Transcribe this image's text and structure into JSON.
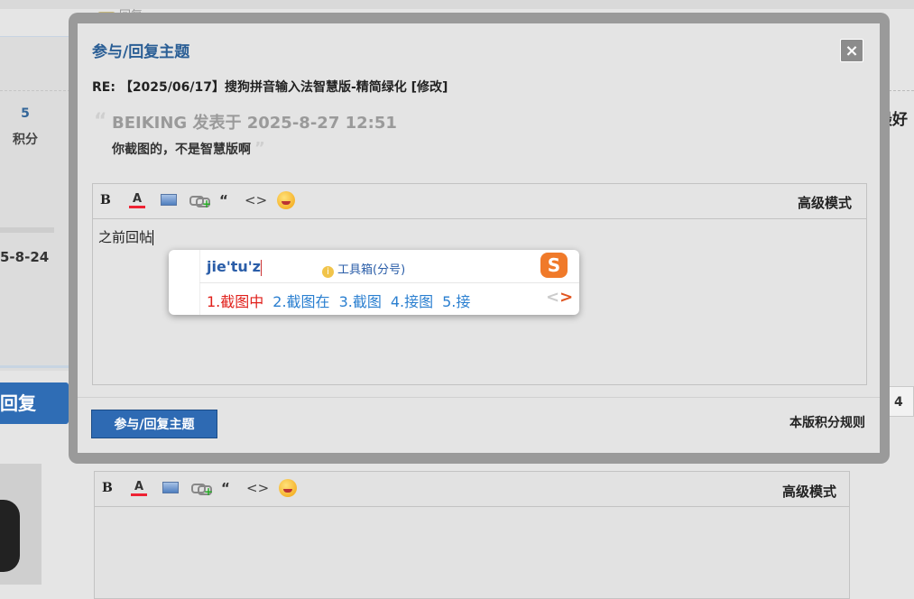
{
  "background": {
    "reply_link": "回复",
    "credits_value": "5",
    "credits_label": "积分",
    "date_fragment": "5-8-24",
    "reply_button": "回复",
    "right_text": "是最好",
    "pager_value": "4",
    "editor": {
      "advanced_mode": "高级模式"
    }
  },
  "dialog": {
    "title": "参与/回复主题",
    "close_glyph": "×",
    "subject": "RE: 【2025/06/17】搜狗拼音输入法智慧版-精简绿化 [修改]",
    "quote": {
      "author_line": "BEIKING 发表于 2025-8-27 12:51",
      "text": "你截图的，不是智慧版啊"
    },
    "editor": {
      "toolbar": {
        "bold": "B",
        "font_color": "A",
        "quote": "“",
        "code": "<>",
        "advanced_mode": "高级模式"
      },
      "content": "之前回帖"
    },
    "submit_label": "参与/回复主题",
    "rules_link": "本版积分规则"
  },
  "ime": {
    "composition": "jie'tu'z",
    "toolbox_label": "工具箱(分号)",
    "candidates": [
      "1.截图中",
      "2.截图在",
      "3.截图",
      "4.接图",
      "5.接"
    ],
    "prev": "<",
    "next": ">",
    "logo": "S"
  },
  "colors": {
    "accent": "#2e6ab3",
    "title_blue": "#2a5e95",
    "ime_active": "#e0201b",
    "ime_candidate": "#2a7fd0",
    "sogou_orange": "#f07a2a"
  }
}
